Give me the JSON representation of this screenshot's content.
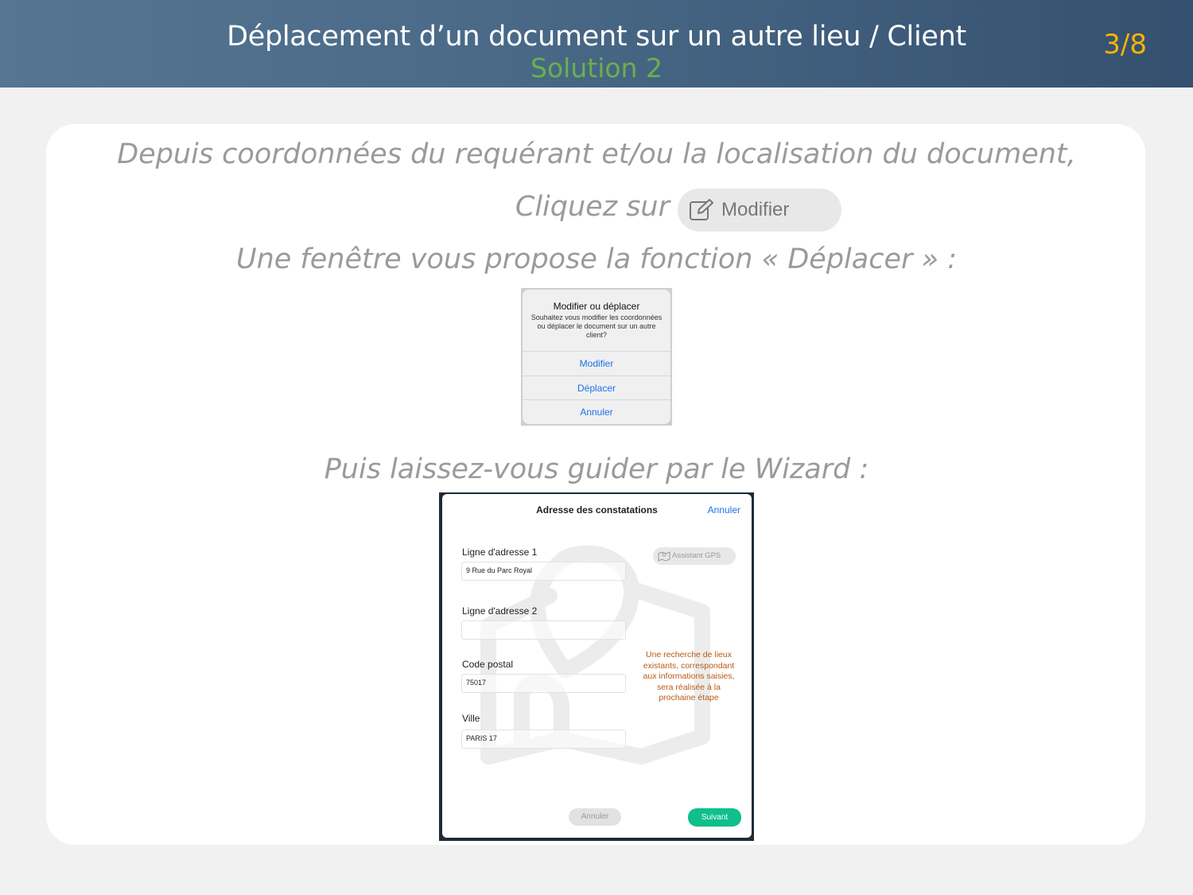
{
  "header": {
    "title": "Déplacement d’un document sur un autre lieu / Client",
    "subtitle": "Solution 2",
    "page": "3/8"
  },
  "content": {
    "line1": "Depuis coordonnées du requérant et/ou la localisation du document,",
    "line2": "Cliquez sur",
    "modifier_button": {
      "label": "Modifier",
      "icon": "edit-icon"
    },
    "line3": "Une fenêtre vous propose la fonction « Déplacer » :",
    "line4": "Puis laissez-vous guider par le Wizard :"
  },
  "dialog": {
    "title": "Modifier ou déplacer",
    "message": "Souhaitez vous modifier les coordonnées ou déplacer le document sur un autre client?",
    "options": [
      "Modifier",
      "Déplacer",
      "Annuler"
    ]
  },
  "wizard": {
    "title": "Adresse des constatations",
    "cancel": "Annuler",
    "gps_button": "Assistant GPS",
    "fields": {
      "address1": {
        "label": "Ligne d'adresse 1",
        "value": "9 Rue du Parc Royal"
      },
      "address2": {
        "label": "Ligne d'adresse 2",
        "value": ""
      },
      "postal": {
        "label": "Code postal",
        "value": "75017"
      },
      "city": {
        "label": "Ville",
        "value": "PARIS 17"
      }
    },
    "note": "Une recherche de lieux existants, correspondant aux informations saisies, sera réalisée à la prochaine étape",
    "buttons": {
      "cancel": "Annuler",
      "next": "Suivant"
    },
    "colors": {
      "note": "#b85a12",
      "next": "#0fbf8c",
      "link": "#1a73e8"
    }
  },
  "colors": {
    "subtitle": "#6ab04c",
    "page": "#f5b400",
    "header": "#4a6a88"
  }
}
